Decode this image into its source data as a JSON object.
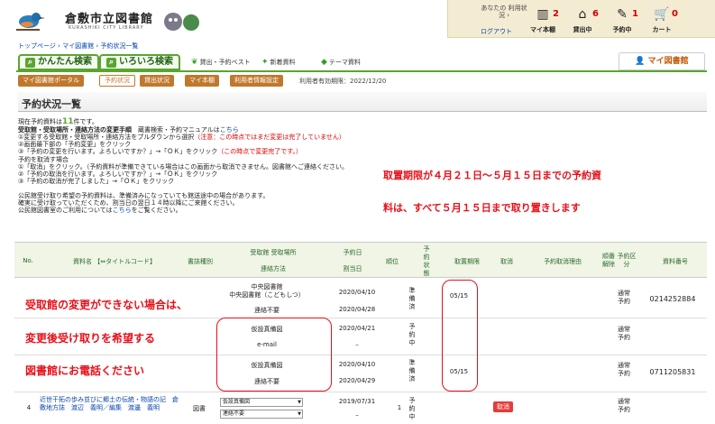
{
  "header": {
    "library_name": "倉敷市立図書館",
    "library_sub": "KURASHIKI CITY LIBRARY",
    "user_label": "あなたの 利用状況 ›",
    "logout": "ログアウト",
    "stats": [
      {
        "label": "マイ本棚",
        "count": "2",
        "icon": "bookshelf-icon"
      },
      {
        "label": "貸出中",
        "count": "6",
        "icon": "house-icon"
      },
      {
        "label": "予約中",
        "count": "1",
        "icon": "reserve-icon"
      },
      {
        "label": "カート",
        "count": "0",
        "icon": "cart-icon"
      }
    ]
  },
  "breadcrumb": "トップページ › マイ図書館 › 予約状況一覧",
  "tabs": {
    "easy": "かんたん検索",
    "detailed": "いろいろ検索"
  },
  "nav_links": [
    "貸出・予約ベスト",
    "新着資料",
    "テーマ資料"
  ],
  "my_library": "マイ図書館",
  "subnav": [
    "マイ図書館ポータル",
    "予約状況",
    "貸出状況",
    "マイ本棚",
    "利用者情報設定"
  ],
  "expiry": "利用者有効期限：2022/12/20",
  "page_title": "予約状況一覧",
  "info": {
    "count_prefix": "現在予約資料は",
    "count": "11",
    "count_suffix": "件です。",
    "change_title": "受取館・受取場所・連絡方法の変更手順",
    "manual_prefix": "蔵書検索・予約マニュアルは",
    "manual_link": "こちら",
    "change1": "①変更する受取館・受取場所・連絡方法をプルダウンから選択",
    "change1_note": "（注意：この時点ではまだ変更は完了していません）",
    "change2": "②画面最下部の「予約変更」をクリック",
    "change3": "③「予約の変更を行います。よろしいですか？」→「ＯＫ」をクリック",
    "change3_note": "（この時点で変更完了です。）",
    "cancel_title": "予約を取消す場合",
    "cancel1": "①「取消」をクリック。（予約資料が準備できている場合はこの画面から取消できません。図書館へご連絡ください。",
    "cancel2": "②「予約の取消を行います。よろしいですか？」→「ＯＫ」をクリック",
    "cancel3": "③「予約の取消が完了しました」→「ＯＫ」をクリック",
    "public_note1": "公民館受け取り希望の予約資料は、準備済みになっていても館送途中の場合があります。",
    "public_note2": "確実に受け取っていただくため、割当日の翌日１４時以降にご来館ください。",
    "public_note3_prefix": "公民館図書室のご利用については",
    "public_note3_link": "こちら",
    "public_note3_suffix": "をご覧ください。"
  },
  "overlay": {
    "right_line1": "取置期限が４月２１日～５月１５日までの予約資",
    "right_line2": "料は、すべて５月１５日まで取り置きします",
    "left_line1": "受取館の変更ができない場合は、",
    "left_line2": "変更後受け取りを希望する",
    "left_line3": "図書館にお電話ください"
  },
  "table": {
    "headers": {
      "no": "No.",
      "title": "資料名 【⇔タイトルコード】",
      "type": "書誌種別",
      "pickup": "受取館 受取場所",
      "contact": "連絡方法",
      "reserve_date": "予約日",
      "assign_date": "割当日",
      "rank": "順位",
      "status": "予約状態",
      "hold_limit": "取置期限",
      "cancel": "取消",
      "cancel_reason": "予約取消理由",
      "order_release": "順番解除",
      "category": "予約区分",
      "material_no": "資料番号"
    },
    "rows": [
      {
        "pickup": "中央図書館",
        "pickup2": "中央図書館（こどもしつ）",
        "contact": "連絡不要",
        "reserve_date": "2020/04/10",
        "assign_date": "2020/04/28",
        "status": "準備済",
        "hold_limit": "05/15",
        "category": "通常予約",
        "material_no": "0214252884"
      },
      {
        "pickup": "仮設真備図",
        "contact": "e-mail",
        "reserve_date": "2020/04/21",
        "assign_date": "–",
        "status": "予約中",
        "hold_limit": "",
        "category": "通常予約",
        "material_no": ""
      },
      {
        "pickup": "仮設真備図",
        "contact": "連絡不要",
        "reserve_date": "2020/04/10",
        "assign_date": "2020/04/29",
        "status": "準備済",
        "hold_limit": "05/15",
        "category": "通常予約",
        "material_no": "0711205831"
      },
      {
        "no": "4",
        "title": "近世干拓の歩み並びに郷土の伝統・物語の記　倉敷地方誌　渡辺　義明／編集　渡邊　義明",
        "type": "図書",
        "pickup": "仮設真備図",
        "contact": "連絡不要",
        "reserve_date": "2019/07/31",
        "assign_date": "–",
        "rank": "1",
        "status": "予約中",
        "cancel": "取消",
        "category": "通常予約"
      }
    ]
  }
}
